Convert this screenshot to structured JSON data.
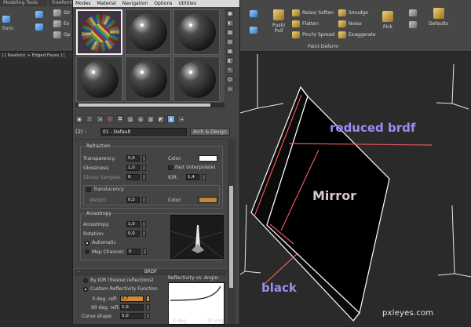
{
  "ribbon": {
    "tabs": [
      "Modeling Tools",
      "Freeform"
    ],
    "left_items": [
      "Str",
      "Ex",
      "Op"
    ],
    "left_label": "form",
    "push_pull": "Push/\nPull",
    "paint_deform": {
      "col1": [
        "Relax/ Soften",
        "Flatten",
        "Pinch/ Spread"
      ],
      "col2": [
        "Smudge",
        "Noise",
        "Exaggerate"
      ],
      "section_label": "Paint Deform"
    },
    "pick_label": "Pick",
    "defaults_label": "Defaults"
  },
  "viewport_label": "] [ Realistic + Edged Faces ] [",
  "material_editor": {
    "menu": [
      "Modes",
      "Material",
      "Navigation",
      "Options",
      "Utilities"
    ],
    "material_name": "01 - Default",
    "material_type": "Arch & Design",
    "slot_field": "(2) :",
    "refraction": {
      "title": "Refraction",
      "transparency_label": "Transparency:",
      "transparency_value": "0,0",
      "glossiness_label": "Glossiness:",
      "glossiness_value": "1,0",
      "glossy_samples_label": "Glossy Samples:",
      "glossy_samples_value": "8",
      "color_label": "Color:",
      "fast_label": "Fast (interpolate)",
      "ior_label": "IOR:",
      "ior_value": "1,4",
      "translucency_label": "Translucency",
      "weight_label": "Weight:",
      "weight_value": "0,5",
      "weight_color_label": "Color:",
      "refraction_color": "#ffffff",
      "translucency_color": "#c08a3a"
    },
    "anisotropy": {
      "title": "Anisotropy",
      "anisotropy_label": "Anisotropy:",
      "anisotropy_value": "1,0",
      "rotation_label": "Rotation:",
      "rotation_value": "0,0",
      "automatic_label": "Automatic",
      "map_channel_label": "Map Channel:",
      "map_channel_value": "0"
    },
    "brdf": {
      "title": "BRDF",
      "by_ior_label": "By IOR (fresnel reflections)",
      "custom_label": "Custom Reflectivity Function",
      "deg0_label": "0 deg. refl:",
      "deg0_value": "0,7",
      "deg90_label": "90 deg. refl:",
      "deg90_value": "1,0",
      "curve_label": "Curve shape:",
      "curve_value": "5,0",
      "graph_title": "Reflectivity vs. Angle:",
      "axis_0": "0 deg",
      "axis_90": "90 deg"
    }
  },
  "annotations": {
    "reduced": "reduced brdf",
    "mirror": "Mirror",
    "black": "black",
    "line_color": "#e8555a",
    "text_color": "#9a8df0"
  },
  "watermark": "pxleyes.com"
}
